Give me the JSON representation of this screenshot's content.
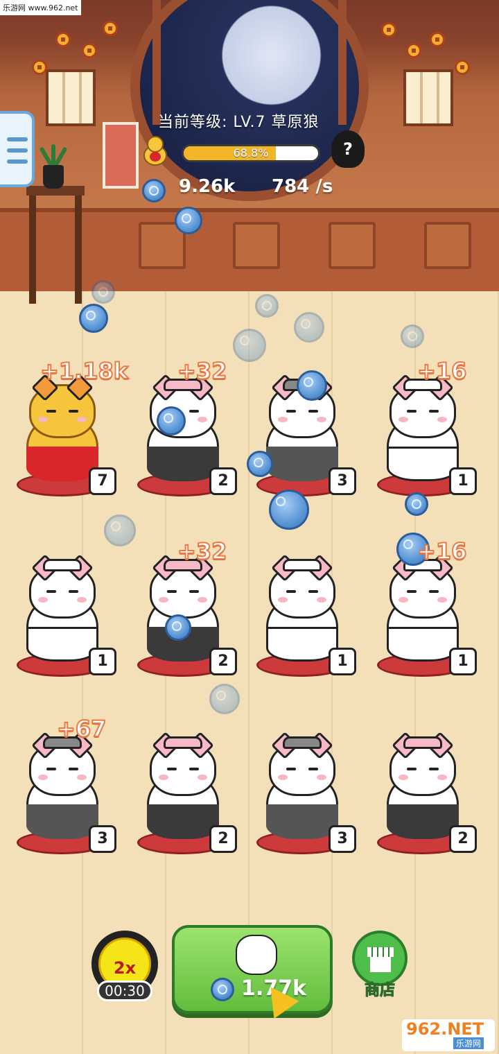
{
  "watermark_top": "乐游网 www.962.net",
  "watermark_bottom": {
    "brand": "962.NET",
    "sub": "乐游网"
  },
  "hud": {
    "level_label": "当前等级:",
    "level_value": "LV.7",
    "level_name": "草原狼",
    "progress_text": "68.8%",
    "progress_fraction": 0.688,
    "next_unknown": "?",
    "coins": "9.26k",
    "rate": "784 /s"
  },
  "grid": [
    {
      "level": "7",
      "gain": "+1.18k",
      "style": "gold"
    },
    {
      "level": "2",
      "gain": "+32",
      "style": "gray"
    },
    {
      "level": "3",
      "gain": "",
      "style": "dark"
    },
    {
      "level": "1",
      "gain": "+16",
      "style": "white"
    },
    {
      "level": "1",
      "gain": "",
      "style": "white"
    },
    {
      "level": "2",
      "gain": "+32",
      "style": "gray"
    },
    {
      "level": "1",
      "gain": "",
      "style": "white"
    },
    {
      "level": "1",
      "gain": "+16",
      "style": "white"
    },
    {
      "level": "3",
      "gain": "+67",
      "style": "dark"
    },
    {
      "level": "2",
      "gain": "",
      "style": "gray"
    },
    {
      "level": "3",
      "gain": "",
      "style": "dark"
    },
    {
      "level": "2",
      "gain": "",
      "style": "gray"
    }
  ],
  "bottom": {
    "boost_multiplier": "2x",
    "boost_timer": "00:30",
    "buy_price": "1.77k",
    "shop_label": "商店"
  },
  "colors": {
    "accent_gold": "#f2b527",
    "buy_green": "#63bd3d",
    "coin_blue": "#5a96d6"
  }
}
